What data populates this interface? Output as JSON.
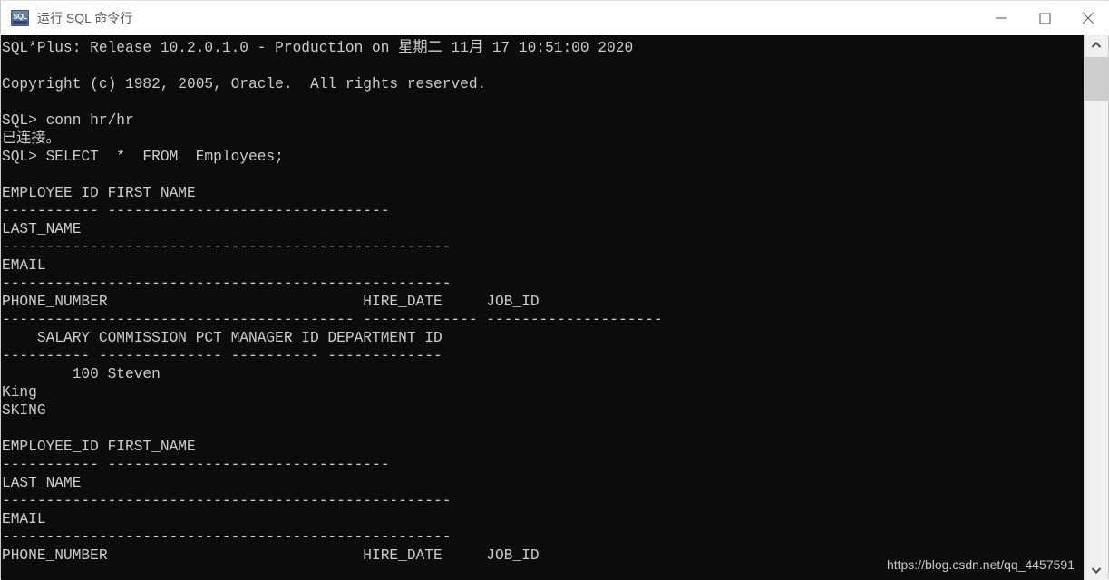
{
  "window": {
    "title": "运行 SQL 命令行",
    "icon": "sql-app-icon",
    "icon_glyph": "SQL",
    "controls": {
      "minimize": "minimize-icon",
      "maximize": "maximize-icon",
      "close": "close-icon"
    }
  },
  "console": {
    "background_color": "#0c0c0c",
    "text_color": "#cccccc",
    "lines": [
      "SQL*Plus: Release 10.2.0.1.0 - Production on 星期二 11月 17 10:51:00 2020",
      "",
      "Copyright (c) 1982, 2005, Oracle.  All rights reserved.",
      "",
      "SQL> conn hr/hr",
      "已连接。",
      "SQL> SELECT  *  FROM  Employees;",
      "",
      "EMPLOYEE_ID FIRST_NAME",
      "----------- --------------------------------",
      "LAST_NAME",
      "---------------------------------------------------",
      "EMAIL",
      "---------------------------------------------------",
      "PHONE_NUMBER                             HIRE_DATE     JOB_ID",
      "---------------------------------------- ------------- --------------------",
      "    SALARY COMMISSION_PCT MANAGER_ID DEPARTMENT_ID",
      "---------- -------------- ---------- -------------",
      "        100 Steven",
      "King",
      "SKING",
      "",
      "EMPLOYEE_ID FIRST_NAME",
      "----------- --------------------------------",
      "LAST_NAME",
      "---------------------------------------------------",
      "EMAIL",
      "---------------------------------------------------",
      "PHONE_NUMBER                             HIRE_DATE     JOB_ID"
    ]
  },
  "scrollbar": {
    "up_arrow": "chevron-up-icon",
    "down_arrow": "chevron-down-icon"
  },
  "watermark": {
    "text": "https://blog.csdn.net/qq_4457591"
  }
}
